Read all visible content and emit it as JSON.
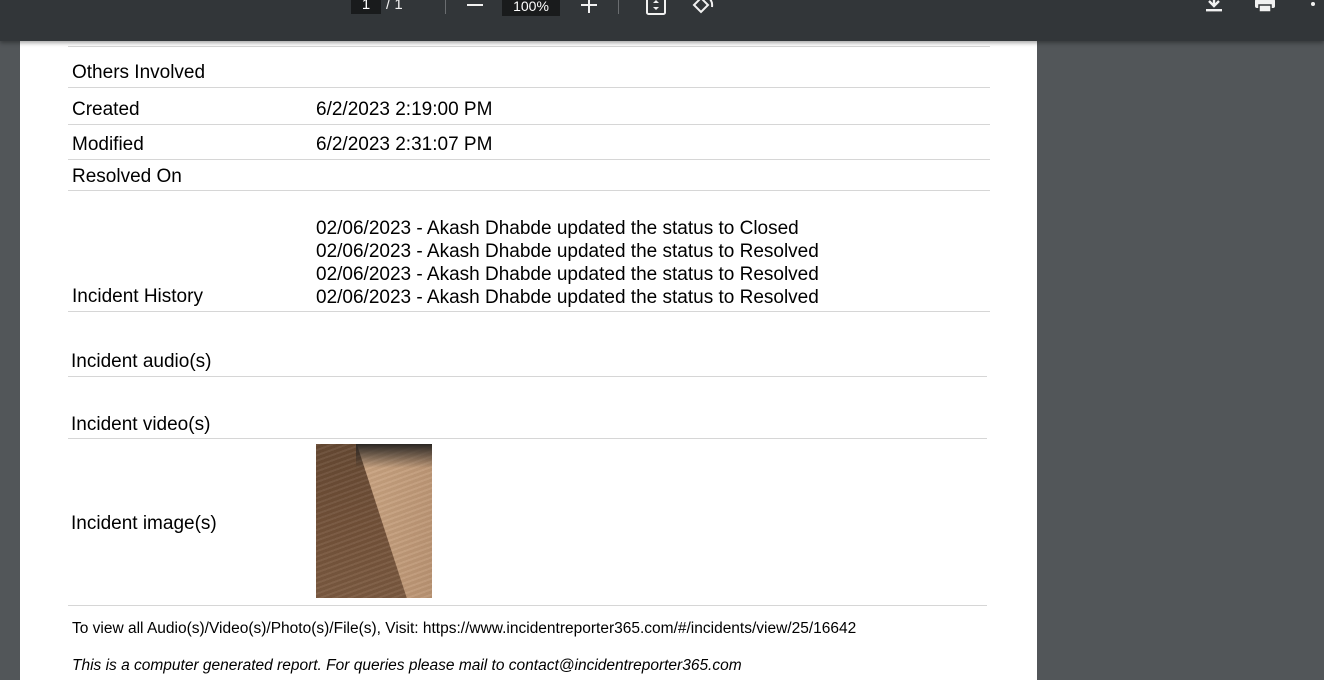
{
  "toolbar": {
    "page_current": "1",
    "page_separator": "/",
    "page_total": "1",
    "zoom": "100%",
    "icons": [
      "zoom-out-icon",
      "zoom-in-icon",
      "fit-page-icon",
      "rotate-icon",
      "download-icon",
      "print-icon",
      "more-icon"
    ]
  },
  "report": {
    "rows": [
      {
        "label": "Others Involved",
        "value": ""
      },
      {
        "label": "Created",
        "value": "6/2/2023 2:19:00 PM"
      },
      {
        "label": "Modified",
        "value": "6/2/2023 2:31:07 PM"
      },
      {
        "label": "Resolved On",
        "value": ""
      }
    ],
    "history_label": "Incident History",
    "history": [
      "02/06/2023 - Akash Dhabde updated the status to Closed",
      "02/06/2023 - Akash Dhabde updated the status to Resolved",
      "02/06/2023 - Akash Dhabde updated the status to Resolved",
      "02/06/2023 - Akash Dhabde updated the status to Resolved"
    ],
    "audio_label": "Incident audio(s)",
    "video_label": "Incident video(s)",
    "image_label": "Incident image(s)",
    "footer_link": "To view all Audio(s)/Video(s)/Photo(s)/File(s), Visit: https://www.incidentreporter365.com/#/incidents/view/25/16642",
    "footer_note": "This is a computer generated report. For queries please mail to contact@incidentreporter365.com"
  }
}
